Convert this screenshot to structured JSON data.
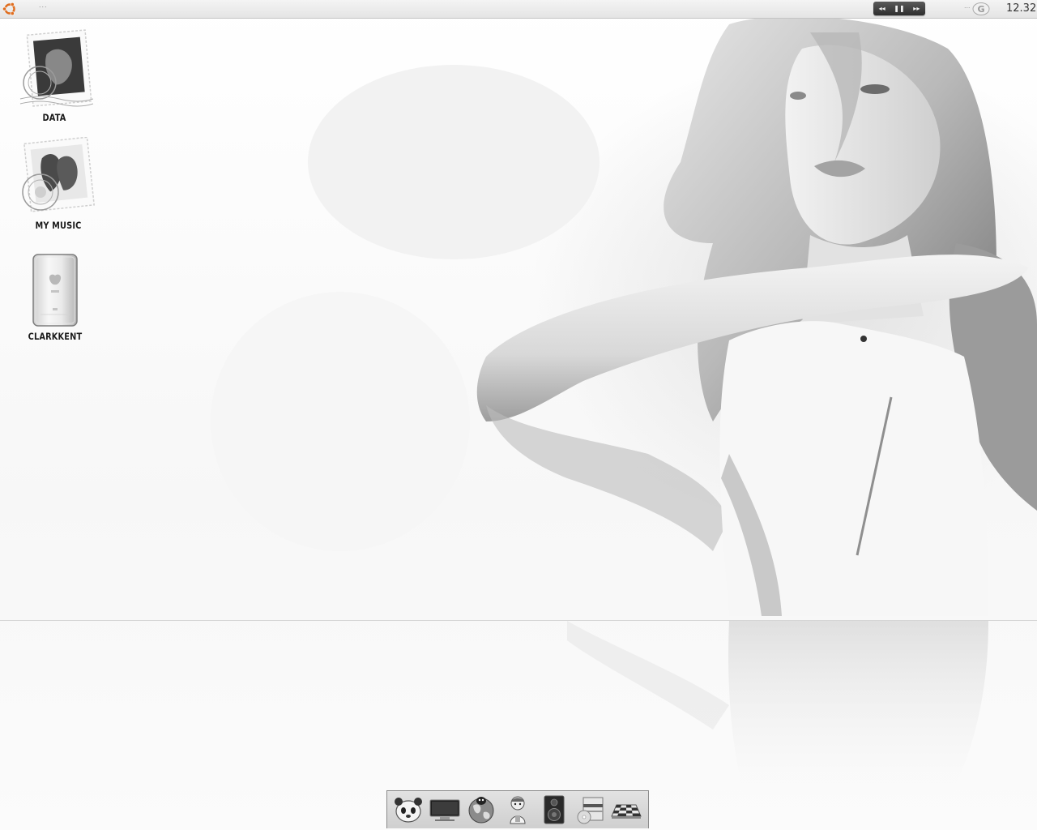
{
  "top_panel": {
    "menu_dots": "...",
    "tray_dots": "...",
    "clock": "12.32",
    "media": {
      "prev": "◂◂",
      "pause": "❚❚",
      "next": "▸▸"
    }
  },
  "desktop": {
    "icons": [
      {
        "label": "DATA",
        "icon": "postage-stamp-drive-icon"
      },
      {
        "label": "MY MUSIC",
        "icon": "postage-stamp-folder-icon"
      },
      {
        "label": "CLARKKENT",
        "icon": "ipod-device-icon"
      }
    ]
  },
  "dock": {
    "items": [
      {
        "icon": "panda-face-icon"
      },
      {
        "icon": "monitor-icon"
      },
      {
        "icon": "penguin-globe-icon"
      },
      {
        "icon": "cartoon-character-icon"
      },
      {
        "icon": "speaker-icon"
      },
      {
        "icon": "cd-package-icon"
      },
      {
        "icon": "chessboard-icon"
      }
    ]
  },
  "colors": {
    "panel_top": "#f4f4f4",
    "panel_bottom": "#e4e4e4",
    "media_bg": "#2e2e2e",
    "label_text": "#1a1a1a",
    "ubuntu_orange": "#e06c1c"
  }
}
